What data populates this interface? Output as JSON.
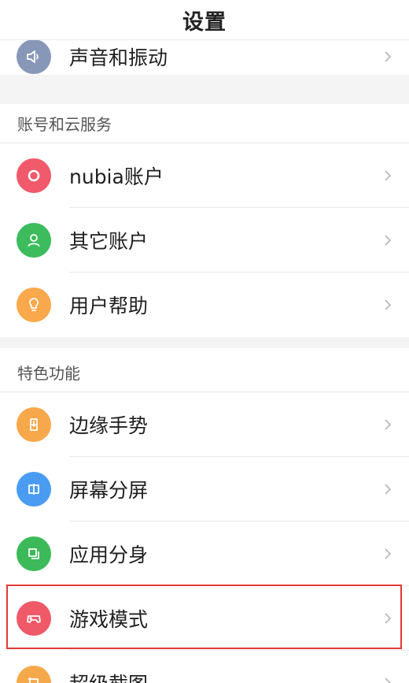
{
  "header": {
    "title": "设置"
  },
  "colors": {
    "sound": "#8797b8",
    "nubia": "#f05a6b",
    "other_account": "#3cbc5c",
    "help": "#f9a84b",
    "edge": "#f7a84a",
    "split": "#4a9cf2",
    "clone": "#3cba59",
    "game": "#ef5968",
    "screenshot": "#f5a84a",
    "highlight": "#e53935"
  },
  "items": {
    "sound": {
      "label": "声音和振动",
      "icon": "speaker-icon"
    },
    "nubia": {
      "label": "nubia账户",
      "icon": "nubia-ring-icon"
    },
    "other_account": {
      "label": "其它账户",
      "icon": "person-icon"
    },
    "help": {
      "label": "用户帮助",
      "icon": "lightbulb-icon"
    },
    "edge": {
      "label": "边缘手势",
      "icon": "edge-gesture-icon"
    },
    "split": {
      "label": "屏幕分屏",
      "icon": "split-screen-icon"
    },
    "clone": {
      "label": "应用分身",
      "icon": "app-clone-icon"
    },
    "game": {
      "label": "游戏模式",
      "icon": "gamepad-icon"
    },
    "screenshot": {
      "label": "超级截图",
      "icon": "screenshot-icon"
    }
  },
  "sections": {
    "account": {
      "title": "账号和云服务"
    },
    "features": {
      "title": "特色功能"
    }
  }
}
